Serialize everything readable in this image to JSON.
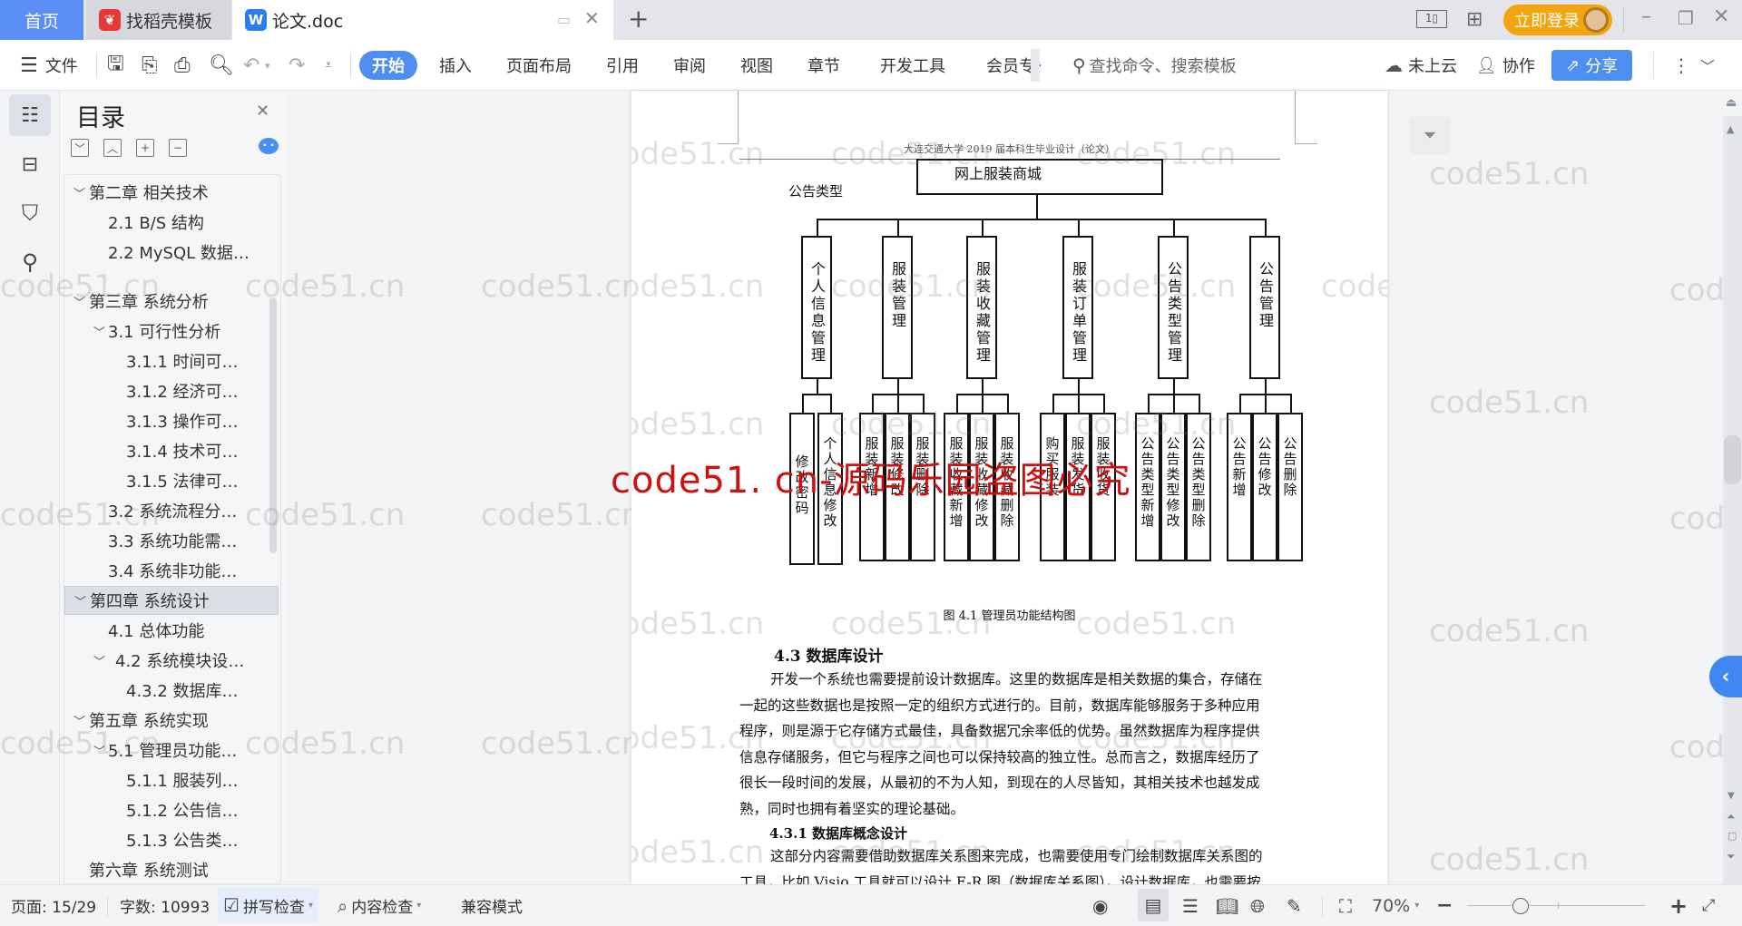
{
  "tabs": [
    {
      "label": "首页",
      "active": false
    },
    {
      "label": "找稻壳模板",
      "icon": "daoke-logo-icon"
    },
    {
      "label": "论文.doc",
      "icon": "wps-writer-icon",
      "active": true
    }
  ],
  "titlebar": {
    "login_label": "立即登录"
  },
  "toolbar": {
    "file_label": "文件",
    "ribbon_tabs": [
      "开始",
      "插入",
      "页面布局",
      "引用",
      "审阅",
      "视图",
      "章节",
      "开发工具",
      "会员专"
    ],
    "active_ribbon": "开始",
    "search_placeholder": "查找命令、搜索模板",
    "cloud_label": "未上云",
    "collab_label": "协作",
    "share_label": "分享"
  },
  "toc": {
    "title": "目录",
    "items": [
      {
        "label": "第二章  相关技术",
        "level": 1,
        "expanded": true
      },
      {
        "label": "2.1 B/S 结构",
        "level": 2
      },
      {
        "label": "2.2 MySQL 数据…",
        "level": 2
      },
      {
        "label": "第三章  系统分析",
        "level": 1,
        "expanded": true
      },
      {
        "label": "3.1 可行性分析",
        "level": 2,
        "expanded": true
      },
      {
        "label": "3.1.1 时间可…",
        "level": 3
      },
      {
        "label": "3.1.2  经济可…",
        "level": 3
      },
      {
        "label": "3.1.3  操作可…",
        "level": 3
      },
      {
        "label": "3.1.4  技术可…",
        "level": 3
      },
      {
        "label": "3.1.5  法律可…",
        "level": 3
      },
      {
        "label": "3.2 系统流程分…",
        "level": 2
      },
      {
        "label": "3.3 系统功能需…",
        "level": 2
      },
      {
        "label": "3.4  系统非功能…",
        "level": 2
      },
      {
        "label": "第四章  系统设计",
        "level": 1,
        "expanded": true,
        "selected": true
      },
      {
        "label": "4.1  总体功能",
        "level": 2
      },
      {
        "label": "4.2  系统模块设…",
        "level": 2,
        "expanded": true
      },
      {
        "label": "4.3.2  数据库…",
        "level": 3
      },
      {
        "label": "第五章  系统实现",
        "level": 1,
        "expanded": true
      },
      {
        "label": "5.1  管理员功能…",
        "level": 2,
        "expanded": true
      },
      {
        "label": "5.1.1  服装列…",
        "level": 3
      },
      {
        "label": "5.1.2  公告信…",
        "level": 3
      },
      {
        "label": "5.1.3  公告类…",
        "level": 3
      },
      {
        "label": "第六章  系统测试",
        "level": 1
      }
    ]
  },
  "document": {
    "header": "大连交通大学 2019 届本科生毕业设计（论文）",
    "stray_label": "公告类型",
    "diagram": {
      "root": "网上服装商城",
      "branches": [
        {
          "label": "个人信息管理",
          "children": [
            "修改密码",
            "个人信息修改"
          ]
        },
        {
          "label": "服装管理",
          "children": [
            "服装新增",
            "服装修改",
            "服装删除"
          ]
        },
        {
          "label": "服装收藏管理",
          "children": [
            "服装收藏新增",
            "服装收藏修改",
            "服装收藏删除"
          ]
        },
        {
          "label": "服装订单管理",
          "children": [
            "购买服装",
            "服装发货",
            "服装收货"
          ]
        },
        {
          "label": "公告类型管理",
          "children": [
            "公告类型新增",
            "公告类型修改",
            "公告类型删除"
          ]
        },
        {
          "label": "公告管理",
          "children": [
            "公告新增",
            "公告修改",
            "公告删除"
          ]
        }
      ],
      "caption": "图 4.1  管理员功能结构图"
    },
    "section_heading": "4.3  数据库设计",
    "paragraph1_lines": [
      "开发一个系统也需要提前设计数据库。这里的数据库是相关数据的集合，存储在",
      "一起的这些数据也是按照一定的组织方式进行的。目前，数据库能够服务于多种应用",
      "程序，则是源于它存储方式最佳，具备数据冗余率低的优势。虽然数据库为程序提供",
      "信息存储服务，但它与程序之间也可以保持较高的独立性。总而言之，数据库经历了",
      "很长一段时间的发展，从最初的不为人知，到现在的人尽皆知，其相关技术也越发成",
      "熟，同时也拥有着坚实的理论基础。"
    ],
    "subsection_heading": "4.3.1  数据库概念设计",
    "paragraph2_lines": [
      "这部分内容需要借助数据库关系图来完成，也需要使用专门绘制数据库关系图的",
      "工具，比如 Visio 工具就可以设计 E-R 图（数据库关系图）。设计数据库，也需要按"
    ]
  },
  "watermark": {
    "text": "code51.cn",
    "red_text": "code51. cn-源码乐园盗图必究",
    "red_color": "#cc1111"
  },
  "statusbar": {
    "page": "页面: 15/29",
    "word_count": "字数: 10993",
    "spell_check": "拼写检查",
    "content_check": "内容检查",
    "compat_mode": "兼容模式",
    "zoom": "70%",
    "zoom_slider_fraction": 0.3
  }
}
